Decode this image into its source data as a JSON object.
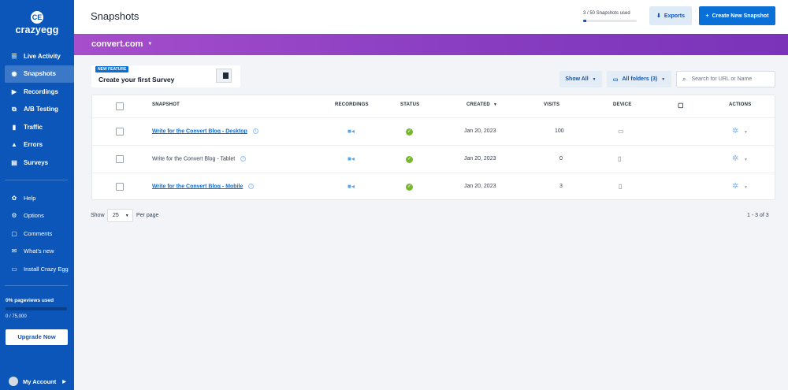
{
  "sidebar": {
    "logo_mark": "CE",
    "logo_text": "crazyegg",
    "items": [
      {
        "label": "Live Activity",
        "icon": "☰"
      },
      {
        "label": "Snapshots",
        "icon": "◉"
      },
      {
        "label": "Recordings",
        "icon": "▶"
      },
      {
        "label": "A/B Testing",
        "icon": "⧉"
      },
      {
        "label": "Traffic",
        "icon": "▮"
      },
      {
        "label": "Errors",
        "icon": "▲"
      },
      {
        "label": "Surveys",
        "icon": "▤"
      }
    ],
    "secondary": [
      {
        "label": "Help",
        "icon": "✿"
      },
      {
        "label": "Options",
        "icon": "⚙"
      },
      {
        "label": "Comments",
        "icon": "▢"
      },
      {
        "label": "What's new",
        "icon": "✉"
      },
      {
        "label": "Install Crazy Egg",
        "icon": "▭"
      }
    ],
    "usage_label": "0% pageviews used",
    "usage_fraction": 0,
    "usage_count": "0 / 75,000",
    "upgrade_label": "Upgrade Now",
    "account_label": "My Account"
  },
  "header": {
    "title": "Snapshots",
    "snapshots_used": "3 / 50 Snapshots used",
    "snapshots_used_fraction": 0.06,
    "exports_label": "Exports",
    "create_label": "Create New Snapshot"
  },
  "site": {
    "name": "convert.com"
  },
  "feature": {
    "badge": "NEW FEATURE",
    "title": "Create your first Survey"
  },
  "toolbar": {
    "show_all": "Show All",
    "folders": "All folders (3)",
    "search_placeholder": "Search for URL or Name"
  },
  "table": {
    "headers": {
      "snapshot": "SNAPSHOT",
      "recordings": "RECORDINGS",
      "status": "STATUS",
      "created": "CREATED",
      "visits": "VISITS",
      "device": "DEVICE",
      "actions": "ACTIONS"
    },
    "rows": [
      {
        "name": "Write for the Convert Blog - Desktop",
        "linked": true,
        "created": "Jan 20, 2023",
        "visits": "100",
        "device": "desktop"
      },
      {
        "name": "Write for the Convert Blog - Tablet",
        "linked": false,
        "created": "Jan 20, 2023",
        "visits": "0",
        "device": "tablet"
      },
      {
        "name": "Write for the Convert Blog - Mobile",
        "linked": true,
        "created": "Jan 20, 2023",
        "visits": "3",
        "device": "mobile"
      }
    ]
  },
  "pagination": {
    "show_label": "Show",
    "per_page_value": "25",
    "per_page_label": "Per page",
    "range": "1 - 3 of 3"
  }
}
